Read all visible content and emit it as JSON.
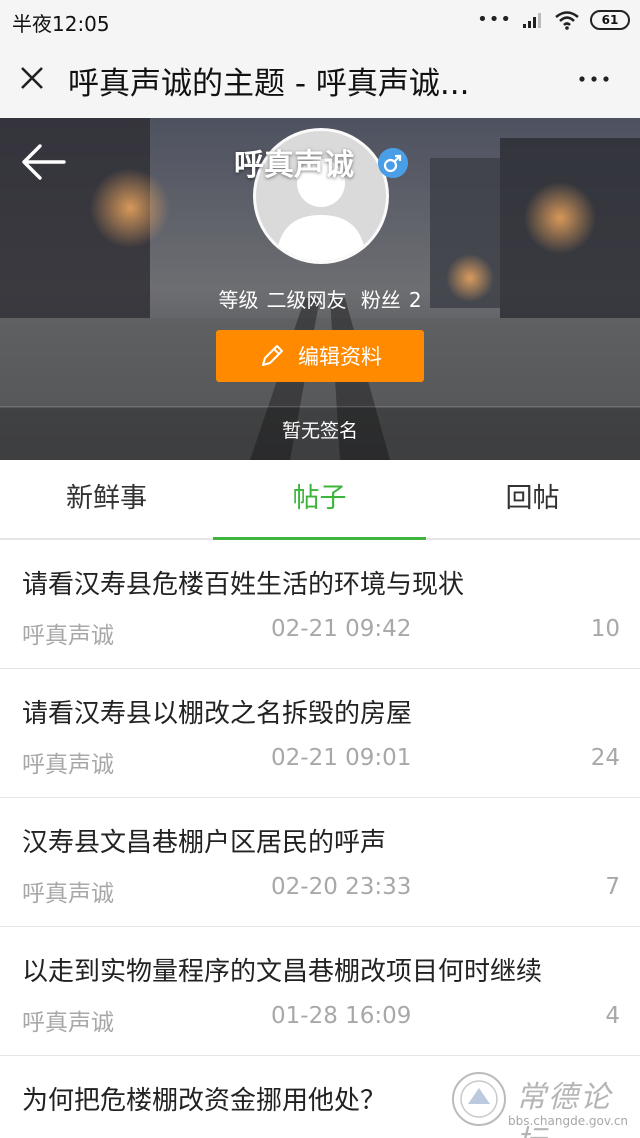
{
  "status_bar": {
    "time": "半夜12:05",
    "signal_dots": "•••",
    "battery": "61"
  },
  "title_bar": {
    "title": "呼真声诚的主题 - 呼真声诚..."
  },
  "profile": {
    "username": "呼真声诚",
    "gender": "male",
    "level_label": "等级",
    "level_value": "二级网友",
    "fans_label": "粉丝",
    "fans_value": "2",
    "edit_button": "编辑资料",
    "signature": "暂无签名"
  },
  "tabs": [
    {
      "label": "新鲜事",
      "active": false
    },
    {
      "label": "帖子",
      "active": true
    },
    {
      "label": "回帖",
      "active": false
    }
  ],
  "posts": [
    {
      "title": "请看汉寿县危楼百姓生活的环境与现状",
      "author": "呼真声诚",
      "time": "02-21 09:42",
      "count": "10"
    },
    {
      "title": "请看汉寿县以棚改之名拆毁的房屋",
      "author": "呼真声诚",
      "time": "02-21 09:01",
      "count": "24"
    },
    {
      "title": "汉寿县文昌巷棚户区居民的呼声",
      "author": "呼真声诚",
      "time": "02-20 23:33",
      "count": "7"
    },
    {
      "title": "以走到实物量程序的文昌巷棚改项目何时继续",
      "author": "呼真声诚",
      "time": "01-28 16:09",
      "count": "4"
    },
    {
      "title": "为何把危楼棚改资金挪用他处？",
      "author": "",
      "time": "",
      "count": ""
    }
  ],
  "watermark": {
    "name": "常德论坛",
    "url": "bbs.changde.gov.cn"
  },
  "colors": {
    "accent_green": "#3db53d",
    "edit_orange": "#ff8a00",
    "gender_blue": "#4a9ee6",
    "muted_text": "#a8a8a8"
  }
}
